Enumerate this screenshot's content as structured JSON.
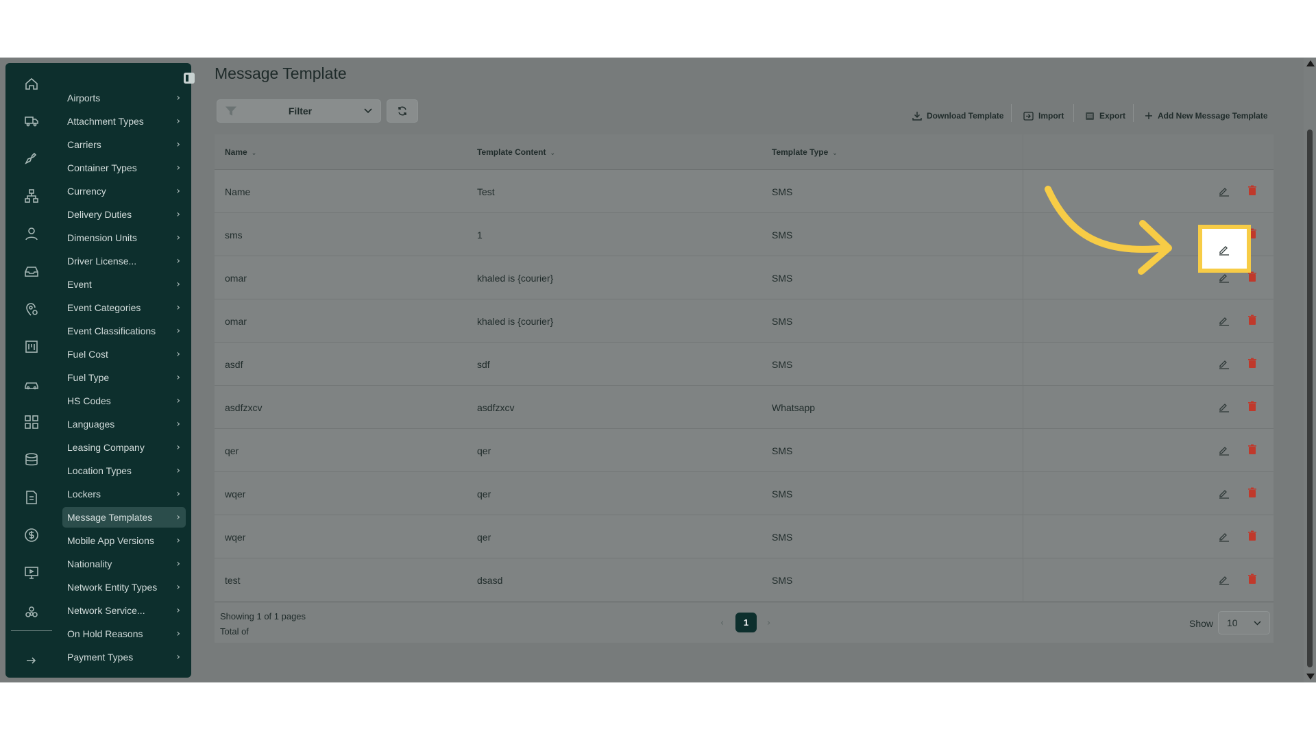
{
  "colors": {
    "sidebar_bg": "#0d2f2d",
    "overlay_bg": "#777b7b",
    "accent": "#f7cc46",
    "delete": "#c0392b",
    "page_active": "#0d2f2d"
  },
  "rail_icons": [
    "home-icon",
    "truck-icon",
    "plane-icon",
    "network-icon",
    "user-icon",
    "inbox-icon",
    "location-settings-icon",
    "kanban-icon",
    "car-icon",
    "grid-icon",
    "database-icon",
    "document-icon",
    "dollar-icon",
    "monitor-icon",
    "hub-icon",
    "logout-icon"
  ],
  "sidebar": {
    "items": [
      {
        "label": "Airports"
      },
      {
        "label": "Attachment Types"
      },
      {
        "label": "Carriers"
      },
      {
        "label": "Container Types"
      },
      {
        "label": "Currency"
      },
      {
        "label": "Delivery Duties"
      },
      {
        "label": "Dimension Units"
      },
      {
        "label": "Driver License..."
      },
      {
        "label": "Event"
      },
      {
        "label": "Event Categories"
      },
      {
        "label": "Event Classifications"
      },
      {
        "label": "Fuel Cost"
      },
      {
        "label": "Fuel Type"
      },
      {
        "label": "HS Codes"
      },
      {
        "label": "Languages"
      },
      {
        "label": "Leasing Company"
      },
      {
        "label": "Location Types"
      },
      {
        "label": "Lockers"
      },
      {
        "label": "Message Templates"
      },
      {
        "label": "Mobile App Versions"
      },
      {
        "label": "Nationality"
      },
      {
        "label": "Network Entity Types"
      },
      {
        "label": "Network Service..."
      },
      {
        "label": "On Hold Reasons"
      },
      {
        "label": "Payment Types"
      }
    ],
    "active_item": "Message Templates"
  },
  "page": {
    "title": "Message Template"
  },
  "toolbar": {
    "filter_label": "Filter",
    "download_label": "Download Template",
    "import_label": "Import",
    "export_label": "Export",
    "add_label": "Add New Message Template"
  },
  "table": {
    "columns": [
      "Name",
      "Template Content",
      "Template Type"
    ],
    "rows": [
      {
        "name": "Name",
        "content": "Test",
        "type": "SMS"
      },
      {
        "name": "sms",
        "content": "1",
        "type": "SMS"
      },
      {
        "name": "omar",
        "content": "khaled is {courier}",
        "type": "SMS"
      },
      {
        "name": "omar",
        "content": "khaled is {courier}",
        "type": "SMS"
      },
      {
        "name": "asdf",
        "content": "sdf",
        "type": "SMS"
      },
      {
        "name": "asdfzxcv",
        "content": "asdfzxcv",
        "type": "Whatsapp"
      },
      {
        "name": "qer",
        "content": "qer",
        "type": "SMS"
      },
      {
        "name": "wqer",
        "content": "qer",
        "type": "SMS"
      },
      {
        "name": "wqer",
        "content": "qer",
        "type": "SMS"
      },
      {
        "name": "test",
        "content": "dsasd",
        "type": "SMS"
      }
    ]
  },
  "pagination": {
    "showing": "Showing 1 of 1 pages",
    "total": "Total of",
    "prev": "‹",
    "current": "1",
    "next": "›",
    "show_label": "Show",
    "page_size": "10"
  }
}
